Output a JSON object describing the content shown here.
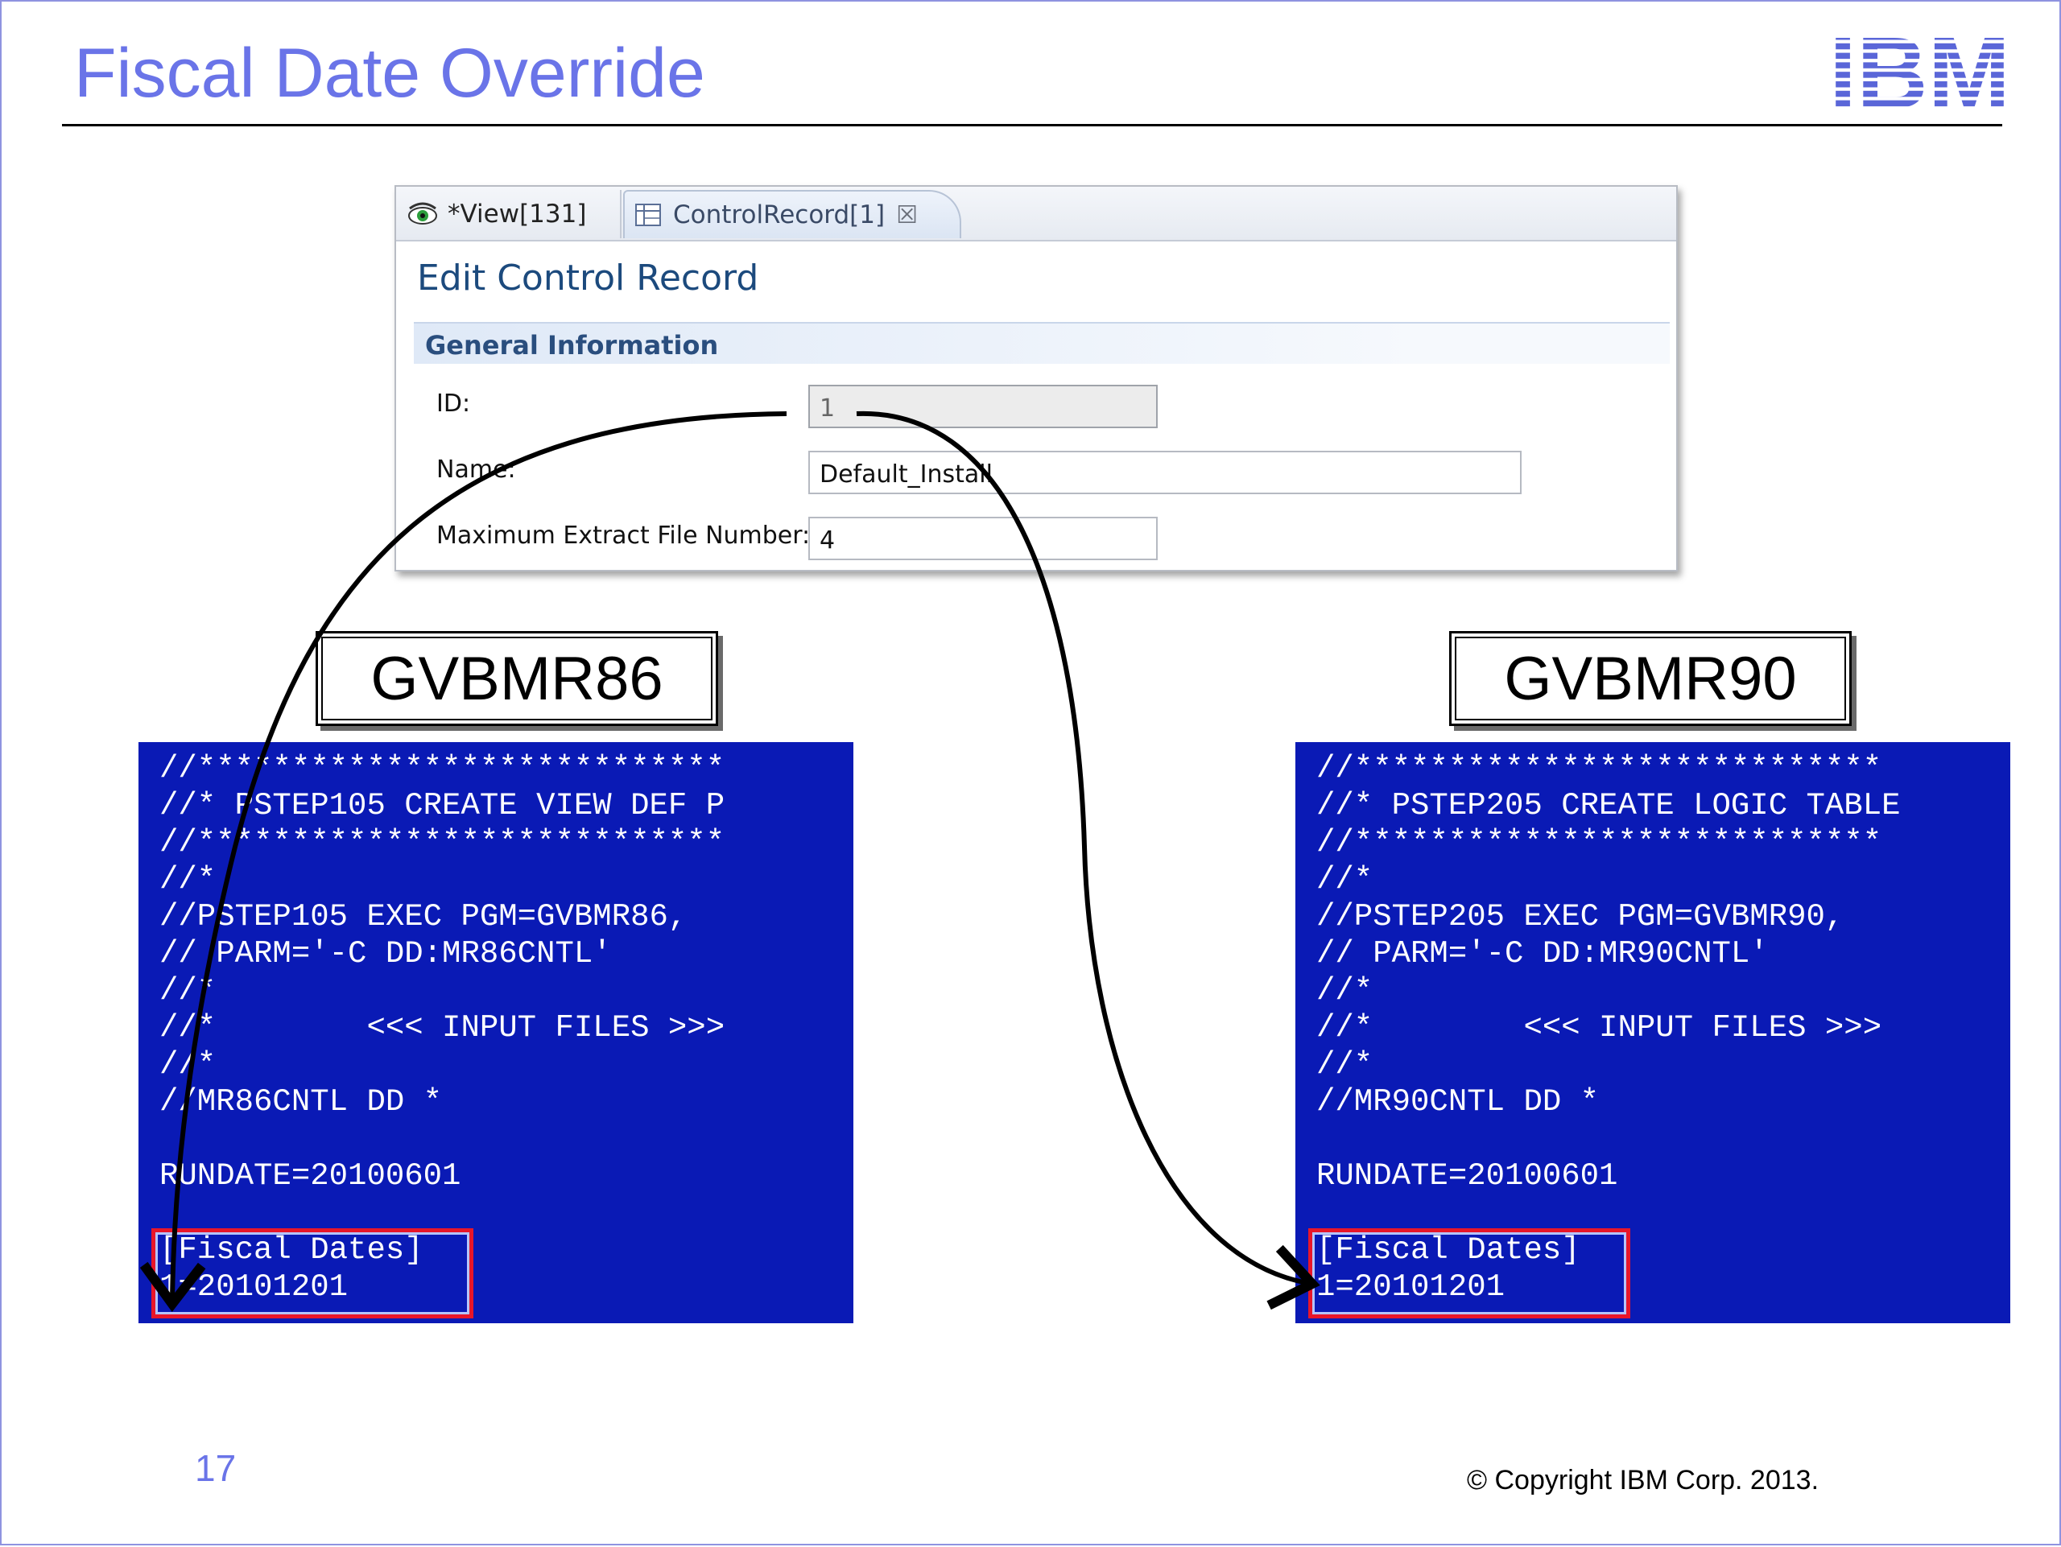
{
  "slide": {
    "title": "Fiscal Date Override",
    "page_number": "17",
    "copyright": "© Copyright IBM Corp. 2013.",
    "logo_text": "IBM",
    "brand_color": "#6a74e8"
  },
  "editor": {
    "tabs": [
      {
        "label": "*View[131]",
        "icon": "eye-icon"
      },
      {
        "label": "ControlRecord[1]",
        "icon": "table-icon",
        "close": "☒"
      }
    ],
    "heading": "Edit Control Record",
    "section": "General Information",
    "fields": {
      "id": {
        "label": "ID:",
        "value": "1"
      },
      "name": {
        "label": "Name:",
        "value": "Default_Install"
      },
      "max_extract": {
        "label": "Maximum Extract File Number:",
        "value": "4"
      }
    }
  },
  "left_program": {
    "label": "GVBMR86",
    "lines": [
      "//****************************",
      "//* PSTEP105 CREATE VIEW DEF P",
      "//****************************",
      "//*",
      "//PSTEP105 EXEC PGM=GVBMR86,",
      "// PARM='-C DD:MR86CNTL'",
      "//*",
      "//*        <<< INPUT FILES >>>",
      "//*",
      "//MR86CNTL DD *",
      "",
      "RUNDATE=20100601",
      "",
      "[Fiscal Dates]",
      "1=20101201"
    ]
  },
  "right_program": {
    "label": "GVBMR90",
    "lines": [
      "//****************************",
      "//* PSTEP205 CREATE LOGIC TABLE",
      "//****************************",
      "//*",
      "//PSTEP205 EXEC PGM=GVBMR90,",
      "// PARM='-C DD:MR90CNTL'",
      "//*",
      "//*        <<< INPUT FILES >>>",
      "//*",
      "//MR90CNTL DD *",
      "",
      "RUNDATE=20100601",
      "",
      "[Fiscal Dates]",
      "1=20101201"
    ]
  },
  "colors": {
    "jcl_background": "#0a1ab5",
    "highlight": "#e8162a"
  }
}
